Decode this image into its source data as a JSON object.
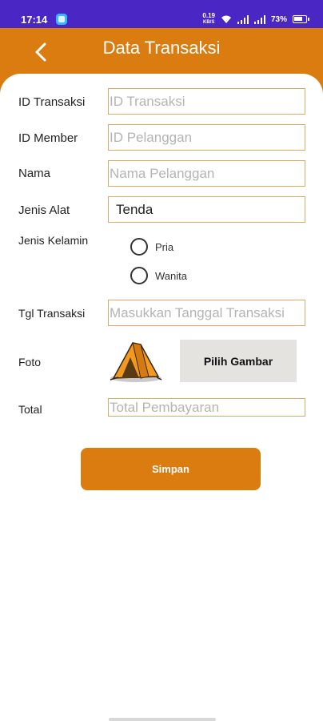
{
  "status_bar": {
    "time": "17:14",
    "net_speed_value": "0.19",
    "net_speed_unit": "KB/S",
    "battery": "73%"
  },
  "header": {
    "title": "Data Transaksi",
    "back_icon": "chevron-left-icon"
  },
  "form": {
    "id_transaksi": {
      "label": "ID Transaksi",
      "placeholder": "ID Transaksi",
      "value": ""
    },
    "id_member": {
      "label": "ID Member",
      "placeholder": "ID Pelanggan",
      "value": ""
    },
    "nama": {
      "label": "Nama",
      "placeholder": "Nama Pelanggan",
      "value": ""
    },
    "jenis_alat": {
      "label": "Jenis Alat",
      "value": "Tenda"
    },
    "jenis_kelamin": {
      "label": "Jenis Kelamin",
      "options": [
        "Pria",
        "Wanita"
      ],
      "selected": null
    },
    "tgl_transaksi": {
      "label": "Tgl Transaksi",
      "placeholder": "Masukkan Tanggal Transaksi",
      "value": ""
    },
    "foto": {
      "label": "Foto",
      "image_icon": "tent-icon",
      "pick_button": "Pilih Gambar"
    },
    "total": {
      "label": "Total",
      "placeholder": "Total Pembayaran",
      "value": ""
    },
    "save_button": "Simpan"
  },
  "colors": {
    "accent": "#db7c10",
    "status_bar": "#4a27c4",
    "field_border": "#e0a866",
    "pick_button_bg": "#e5e3df"
  }
}
